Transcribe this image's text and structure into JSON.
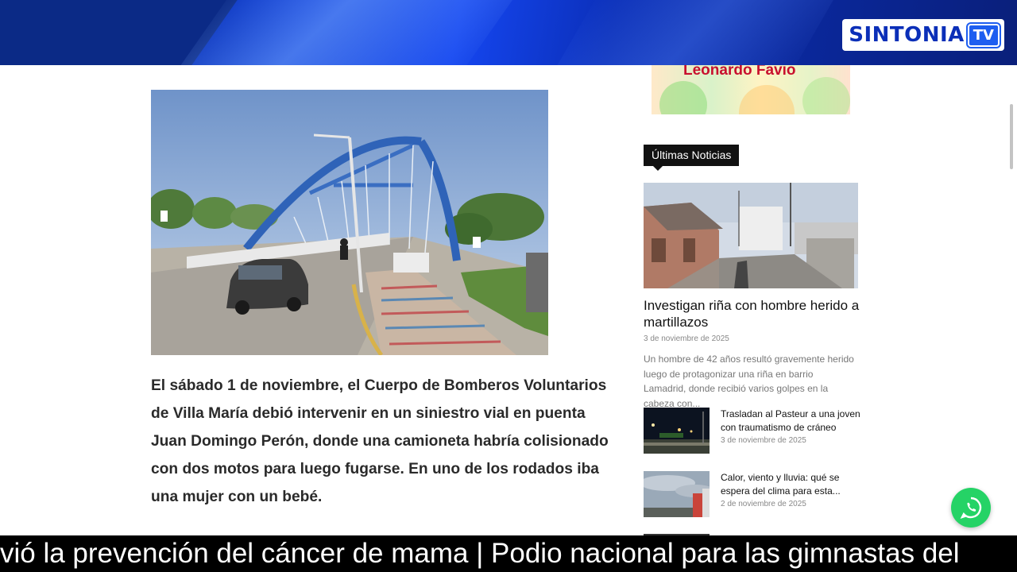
{
  "header": {
    "logo_text": "SINTONIA",
    "logo_tv": "TV"
  },
  "ad": {
    "text": "Leonardo Favio"
  },
  "article": {
    "image_description": "bridge-photo",
    "body": "El sábado 1 de noviembre, el Cuerpo de Bomberos Voluntarios de Villa María debió intervenir en un siniestro vial en puenta Juan Domingo Perón, donde una camioneta habría colisionado con dos motos para luego fugarse. En uno de los rodados iba una mujer con un bebé."
  },
  "sidebar": {
    "section_title": "Últimas Noticias",
    "featured": {
      "title": "Investigan riña con hombre herido a martillazos",
      "date": "3 de noviembre de 2025",
      "excerpt": "Un hombre de 42 años resultó gravemente herido luego de protagonizar una riña en barrio Lamadrid, donde recibió varios golpes en la cabeza con..."
    },
    "items": [
      {
        "title": "Trasladan al Pasteur a una joven con traumatismo de cráneo",
        "date": "3 de noviembre de 2025"
      },
      {
        "title": "Calor, viento y lluvia: qué se espera del clima para esta...",
        "date": "2 de noviembre de 2025"
      }
    ]
  },
  "ticker": {
    "text": "vió la prevención del cáncer de mama | Podio nacional para las gimnastas del"
  },
  "colors": {
    "brand_blue": "#0b2fb8",
    "whatsapp_green": "#25d366",
    "ticker_bg": "#000000"
  },
  "icons": {
    "whatsapp": "whatsapp-icon"
  }
}
